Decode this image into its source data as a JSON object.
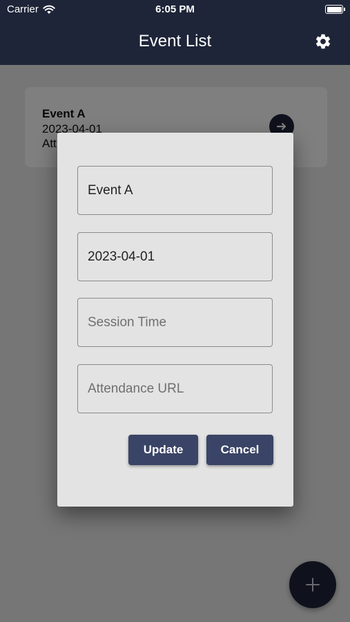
{
  "status_bar": {
    "carrier": "Carrier",
    "time": "6:05 PM"
  },
  "app_bar": {
    "title": "Event List",
    "settings_icon": "gear-icon"
  },
  "event_card": {
    "name": "Event A",
    "date": "2023-04-01",
    "third_line_visible": "Att",
    "action_icon": "arrow-right-icon"
  },
  "dialog": {
    "fields": [
      {
        "value": "Event A",
        "placeholder": ""
      },
      {
        "value": "2023-04-01",
        "placeholder": ""
      },
      {
        "value": "",
        "placeholder": "Session Time"
      },
      {
        "value": "",
        "placeholder": "Attendance URL"
      }
    ],
    "update_label": "Update",
    "cancel_label": "Cancel"
  },
  "fab": {
    "icon": "plus-icon"
  },
  "colors": {
    "navy": "#1f2538",
    "button": "#3a4466",
    "dialog_bg": "#e3e3e3"
  }
}
